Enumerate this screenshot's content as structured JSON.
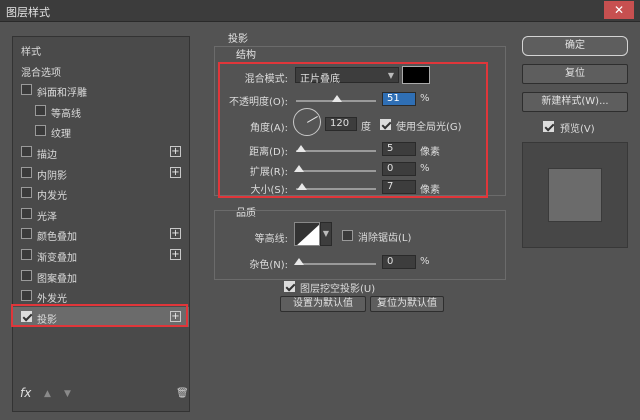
{
  "window": {
    "title": "图层样式",
    "close": "✕"
  },
  "sidebar": {
    "items": [
      {
        "label": "样式",
        "checkbox": false,
        "plus": false,
        "checked": false
      },
      {
        "label": "混合选项",
        "checkbox": false,
        "plus": false,
        "checked": false
      },
      {
        "label": "斜面和浮雕",
        "checkbox": true,
        "plus": false,
        "checked": false
      },
      {
        "label": "等高线",
        "checkbox": true,
        "plus": false,
        "checked": false
      },
      {
        "label": "纹理",
        "checkbox": true,
        "plus": false,
        "checked": false
      },
      {
        "label": "描边",
        "checkbox": true,
        "plus": true,
        "checked": false
      },
      {
        "label": "内阴影",
        "checkbox": true,
        "plus": true,
        "checked": false
      },
      {
        "label": "内发光",
        "checkbox": true,
        "plus": false,
        "checked": false
      },
      {
        "label": "光泽",
        "checkbox": true,
        "plus": false,
        "checked": false
      },
      {
        "label": "颜色叠加",
        "checkbox": true,
        "plus": true,
        "checked": false
      },
      {
        "label": "渐变叠加",
        "checkbox": true,
        "plus": true,
        "checked": false
      },
      {
        "label": "图案叠加",
        "checkbox": true,
        "plus": false,
        "checked": false
      },
      {
        "label": "外发光",
        "checkbox": true,
        "plus": false,
        "checked": false
      },
      {
        "label": "投影",
        "checkbox": true,
        "plus": true,
        "checked": true
      }
    ],
    "fx_label": "fx",
    "plus_glyph": "+"
  },
  "shadow": {
    "section_title": "投影",
    "structure_title": "结构",
    "blend_mode_label": "混合模式:",
    "blend_mode_value": "正片叠底",
    "color": "#000000",
    "opacity_label": "不透明度(O):",
    "opacity_value": "51",
    "opacity_unit": "%",
    "opacity_fraction": 0.51,
    "angle_label": "角度(A):",
    "angle_value": "120",
    "angle_unit": "度",
    "global_light_label": "使用全局光(G)",
    "global_light_checked": true,
    "distance_label": "距离(D):",
    "distance_value": "5",
    "distance_unit": "像素",
    "spread_label": "扩展(R):",
    "spread_value": "0",
    "spread_unit": "%",
    "size_label": "大小(S):",
    "size_value": "7",
    "size_unit": "像素"
  },
  "quality": {
    "title": "品质",
    "contour_label": "等高线:",
    "antialias_label": "消除锯齿(L)",
    "antialias_checked": false,
    "noise_label": "杂色(N):",
    "noise_value": "0",
    "noise_unit": "%",
    "knockout_label": "图层挖空投影(U)",
    "knockout_checked": true,
    "set_default_label": "设置为默认值",
    "reset_default_label": "复位为默认值"
  },
  "buttons": {
    "ok": "确定",
    "reset": "复位",
    "new_style": "新建样式(W)...",
    "preview_label": "预览(V)",
    "preview_checked": true
  },
  "colors": {
    "highlight": "#e0363a",
    "selected_field": "#2f6fb5"
  }
}
